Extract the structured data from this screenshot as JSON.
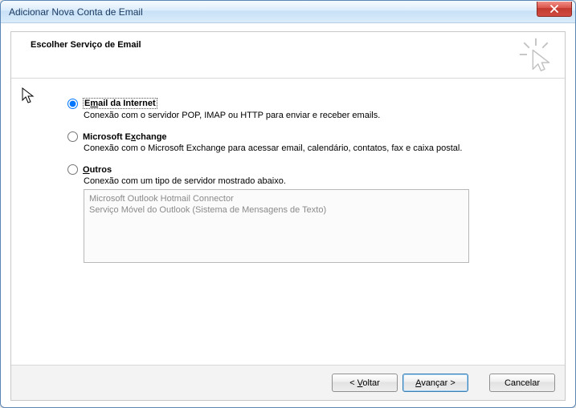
{
  "window": {
    "title": "Adicionar Nova Conta de Email"
  },
  "header": {
    "heading": "Escolher Serviço de Email"
  },
  "options": {
    "internet": {
      "label_pre": "E",
      "label_ul": "m",
      "label_post": "ail da Internet",
      "desc": "Conexão com o servidor POP, IMAP ou HTTP para enviar e receber emails.",
      "checked": true
    },
    "exchange": {
      "label_pre": "Microsoft E",
      "label_ul": "x",
      "label_post": "change",
      "desc": "Conexão com o Microsoft Exchange para acessar email, calendário, contatos, fax e caixa postal.",
      "checked": false
    },
    "other": {
      "label_pre": "",
      "label_ul": "O",
      "label_post": "utros",
      "desc": "Conexão com um tipo de servidor mostrado abaixo.",
      "checked": false
    }
  },
  "other_list": {
    "item1": "Microsoft Outlook Hotmail Connector",
    "item2": "Serviço Móvel do Outlook (Sistema de Mensagens de Texto)"
  },
  "buttons": {
    "back_pre": "< ",
    "back_ul": "V",
    "back_post": "oltar",
    "next_pre": "",
    "next_ul": "A",
    "next_post": "vançar >",
    "cancel": "Cancelar"
  }
}
